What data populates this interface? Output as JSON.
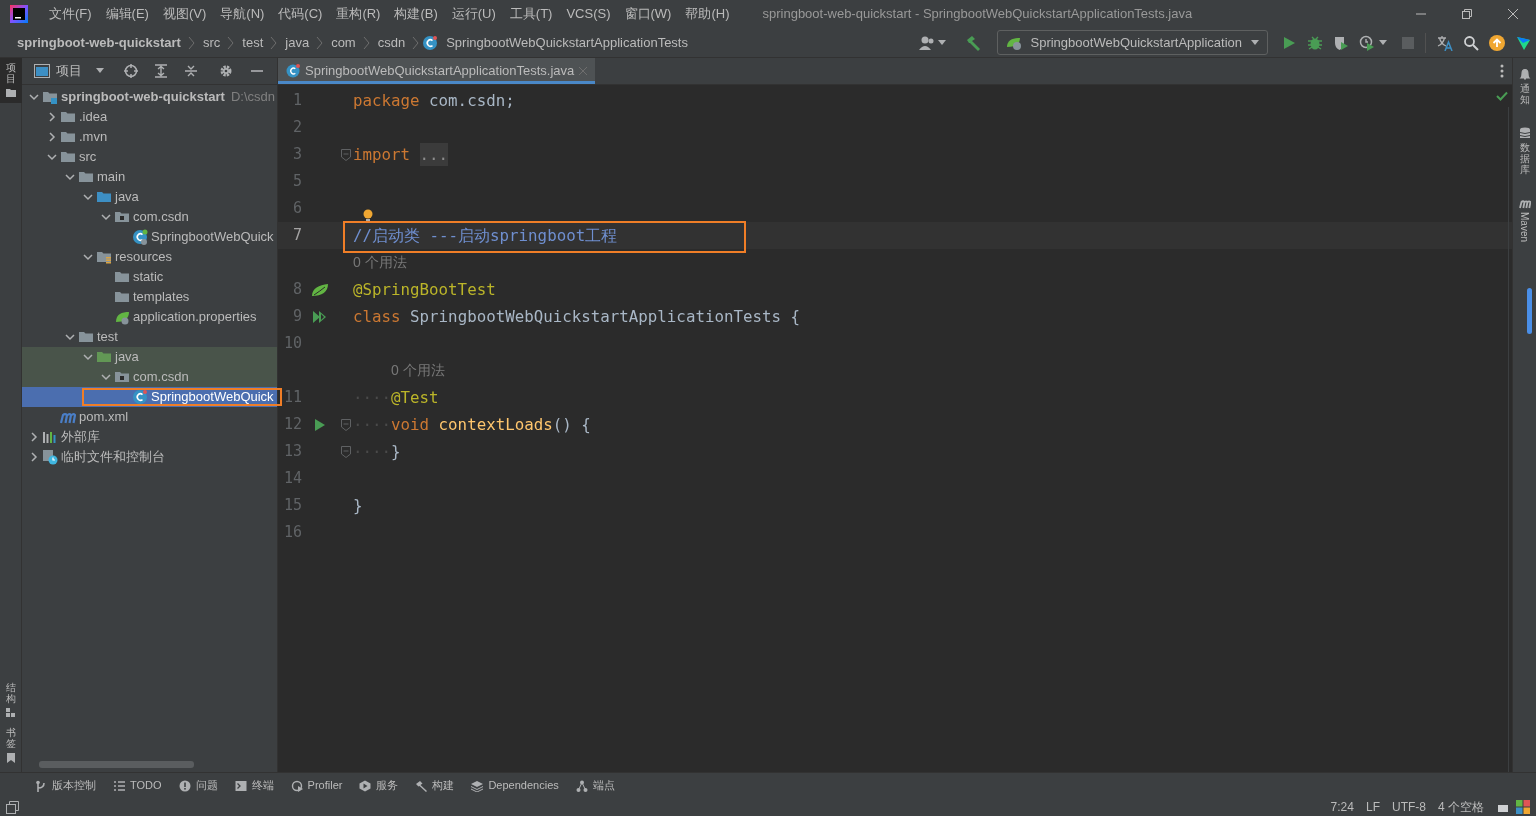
{
  "window": {
    "title": "springboot-web-quickstart - SpringbootWebQuickstartApplicationTests.java"
  },
  "menu": [
    "文件(F)",
    "编辑(E)",
    "视图(V)",
    "导航(N)",
    "代码(C)",
    "重构(R)",
    "构建(B)",
    "运行(U)",
    "工具(T)",
    "VCS(S)",
    "窗口(W)",
    "帮助(H)"
  ],
  "breadcrumbs": [
    {
      "text": "springboot-web-quickstart",
      "kind": "project"
    },
    {
      "text": "src",
      "kind": "dir"
    },
    {
      "text": "test",
      "kind": "dir"
    },
    {
      "text": "java",
      "kind": "dir"
    },
    {
      "text": "com",
      "kind": "dir"
    },
    {
      "text": "csdn",
      "kind": "dir"
    },
    {
      "text": "SpringbootWebQuickstartApplicationTests",
      "kind": "class"
    }
  ],
  "run_config": {
    "label": "SpringbootWebQuickstartApplication"
  },
  "left_strip": [
    {
      "label": "项目",
      "selected": true,
      "kind": "project"
    },
    {
      "label": "结构",
      "selected": false,
      "kind": "structure"
    },
    {
      "label": "书签",
      "selected": false,
      "kind": "bookmarks"
    }
  ],
  "project_panel": {
    "title": "项目",
    "tree": [
      {
        "label": "springboot-web-quickstart",
        "path": "D:\\csdn",
        "kind": "module",
        "expanded": true,
        "selected": false,
        "children": [
          {
            "label": ".idea",
            "kind": "folder",
            "expanded": false,
            "selected": false
          },
          {
            "label": ".mvn",
            "kind": "folder",
            "expanded": false,
            "selected": false
          },
          {
            "label": "src",
            "kind": "folder",
            "expanded": true,
            "selected": false,
            "children": [
              {
                "label": "main",
                "kind": "folder",
                "expanded": true,
                "selected": false,
                "children": [
                  {
                    "label": "java",
                    "kind": "source-folder",
                    "expanded": true,
                    "selected": false,
                    "children": [
                      {
                        "label": "com.csdn",
                        "kind": "package",
                        "expanded": true,
                        "selected": false,
                        "children": [
                          {
                            "label": "SpringbootWebQuick",
                            "kind": "spring-class",
                            "selected": false
                          }
                        ]
                      }
                    ]
                  },
                  {
                    "label": "resources",
                    "kind": "resources-folder",
                    "expanded": true,
                    "selected": false,
                    "children": [
                      {
                        "label": "static",
                        "kind": "folder",
                        "selected": false
                      },
                      {
                        "label": "templates",
                        "kind": "folder",
                        "selected": false
                      },
                      {
                        "label": "application.properties",
                        "kind": "properties",
                        "selected": false
                      }
                    ]
                  }
                ]
              },
              {
                "label": "test",
                "kind": "folder",
                "expanded": true,
                "selected": false,
                "children": [
                  {
                    "label": "java",
                    "kind": "test-folder",
                    "expanded": true,
                    "selected": false,
                    "test_scope": true,
                    "children": [
                      {
                        "label": "com.csdn",
                        "kind": "package",
                        "expanded": true,
                        "selected": false,
                        "test_scope": true,
                        "children": [
                          {
                            "label": "SpringbootWebQuick",
                            "kind": "test-class",
                            "selected": true,
                            "highlighted": true
                          }
                        ]
                      }
                    ]
                  }
                ]
              }
            ]
          },
          {
            "label": "pom.xml",
            "kind": "maven",
            "selected": false
          }
        ]
      },
      {
        "label": "外部库",
        "kind": "libraries",
        "expanded": false,
        "selected": false
      },
      {
        "label": "临时文件和控制台",
        "kind": "scratches",
        "expanded": false,
        "selected": false
      }
    ]
  },
  "editor": {
    "tabs": [
      {
        "label": "SpringbootWebQuickstartApplicationTests.java",
        "selected": true
      }
    ],
    "lines": [
      {
        "number": "1",
        "tokens": [
          {
            "kind": "keyword",
            "text": "package"
          },
          {
            "kind": "plain",
            "text": " com.csdn;"
          }
        ]
      },
      {
        "number": "2"
      },
      {
        "number": "3",
        "fold": true,
        "tokens": [
          {
            "kind": "keyword",
            "text": "import"
          },
          {
            "kind": "folded",
            "text": "..."
          }
        ]
      },
      {
        "number": "5"
      },
      {
        "number": "6",
        "gutter_icon": {
          "kind": "bulb"
        }
      },
      {
        "number": "7",
        "current": true,
        "highlighted": true,
        "tokens": [
          {
            "kind": "comment",
            "text": "//启动类 ---启动springboot工程"
          }
        ]
      },
      {
        "kind": "hint",
        "text": "0 个用法"
      },
      {
        "number": "8",
        "gutter_icon": {
          "kind": "spring"
        },
        "tokens": [
          {
            "kind": "annotation",
            "text": "@SpringBootTest"
          }
        ]
      },
      {
        "number": "9",
        "gutter_icon": {
          "kind": "run-all"
        },
        "tokens": [
          {
            "kind": "keyword",
            "text": "class"
          },
          {
            "kind": "plain",
            "text": " SpringbootWebQuickstartApplicationTests {"
          }
        ]
      },
      {
        "number": "10"
      },
      {
        "kind": "hint",
        "indent": true,
        "text": "0 个用法"
      },
      {
        "number": "11",
        "tokens": [
          {
            "kind": "whitespace",
            "text": "····"
          },
          {
            "kind": "annotation",
            "text": "@Test"
          }
        ]
      },
      {
        "number": "12",
        "gutter_icon": {
          "kind": "run"
        },
        "fold": true,
        "tokens": [
          {
            "kind": "whitespace",
            "text": "····"
          },
          {
            "kind": "keyword",
            "text": "void"
          },
          {
            "kind": "method",
            "text": "contextLoads"
          },
          {
            "kind": "plain",
            "text": "() {"
          }
        ]
      },
      {
        "number": "13",
        "fold": true,
        "tokens": [
          {
            "kind": "whitespace",
            "text": "····"
          },
          {
            "kind": "plain",
            "text": "}"
          }
        ]
      },
      {
        "number": "14"
      },
      {
        "number": "15",
        "tokens": [
          {
            "kind": "plain",
            "text": "}"
          }
        ]
      },
      {
        "number": "16"
      }
    ]
  },
  "right_strip": [
    {
      "label": "通知",
      "kind": "notifications"
    },
    {
      "label": "数据库",
      "kind": "database"
    },
    {
      "label": "Maven",
      "kind": "maven"
    }
  ],
  "tool_windows": [
    {
      "label": "版本控制",
      "kind": "vcs"
    },
    {
      "label": "TODO",
      "kind": "todo"
    },
    {
      "label": "问题",
      "kind": "problems"
    },
    {
      "label": "终端",
      "kind": "terminal"
    },
    {
      "label": "Profiler",
      "kind": "profiler"
    },
    {
      "label": "服务",
      "kind": "services"
    },
    {
      "label": "构建",
      "kind": "build"
    },
    {
      "label": "Dependencies",
      "kind": "dependencies"
    },
    {
      "label": "端点",
      "kind": "endpoints"
    }
  ],
  "status_bar": {
    "items": [
      "7:24",
      "LF",
      "UTF-8",
      "4 个空格"
    ]
  }
}
